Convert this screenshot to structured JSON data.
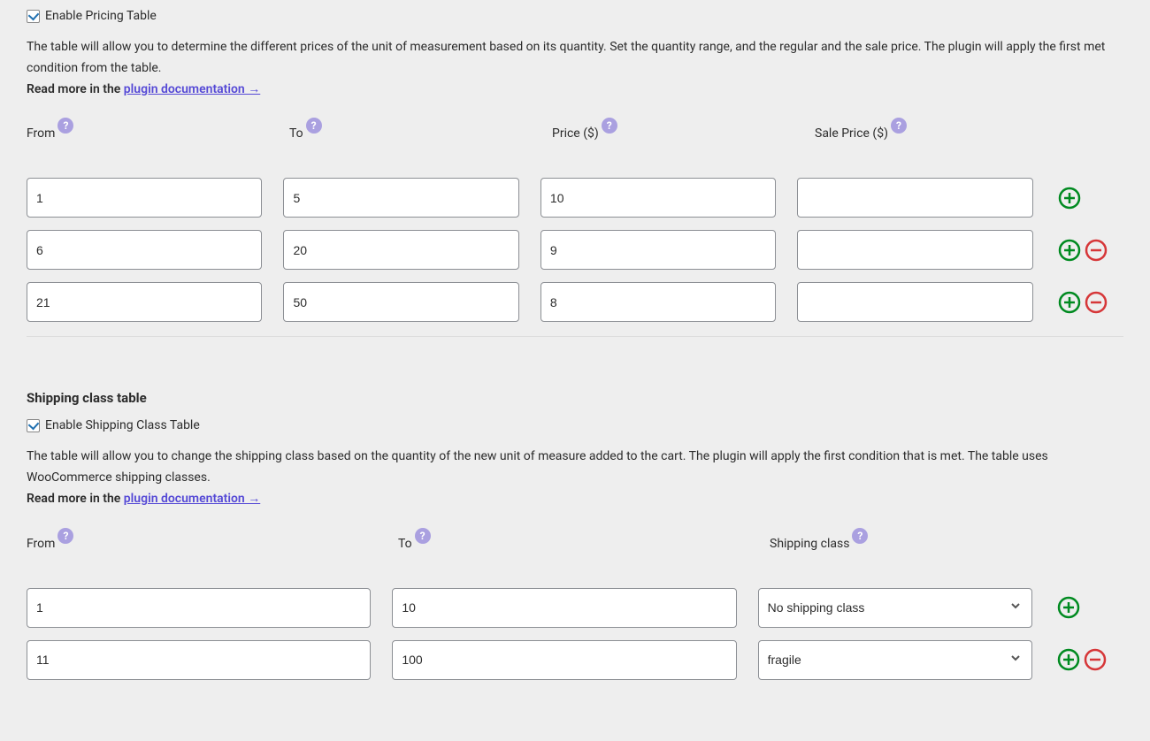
{
  "pricing": {
    "enable_label": "Enable Pricing Table",
    "enabled": true,
    "desc": "The table will allow you to determine the different prices of the unit of measurement based on its quantity. Set the quantity range, and the regular and the sale price. The plugin will apply the first met condition from the table.",
    "read_more_prefix": "Read more in the ",
    "doc_link_text": "plugin documentation →",
    "headers": {
      "from": "From",
      "to": "To",
      "price": "Price ($)",
      "sale": "Sale Price ($)"
    },
    "rows": [
      {
        "from": "1",
        "to": "5",
        "price": "10",
        "sale": ""
      },
      {
        "from": "6",
        "to": "20",
        "price": "9",
        "sale": ""
      },
      {
        "from": "21",
        "to": "50",
        "price": "8",
        "sale": ""
      }
    ]
  },
  "shipping": {
    "title": "Shipping class table",
    "enable_label": "Enable Shipping Class Table",
    "enabled": true,
    "desc": "The table will allow you to change the shipping class based on the quantity of the new unit of measure added to the cart. The plugin will apply the first condition that is met. The table uses WooCommerce shipping classes.",
    "read_more_prefix": "Read more in the ",
    "doc_link_text": "plugin documentation →",
    "headers": {
      "from": "From",
      "to": "To",
      "class": "Shipping class"
    },
    "rows": [
      {
        "from": "1",
        "to": "10",
        "class": "No shipping class"
      },
      {
        "from": "11",
        "to": "100",
        "class": "fragile"
      }
    ],
    "options": [
      "No shipping class",
      "fragile"
    ]
  },
  "icons": {
    "help": "?"
  }
}
